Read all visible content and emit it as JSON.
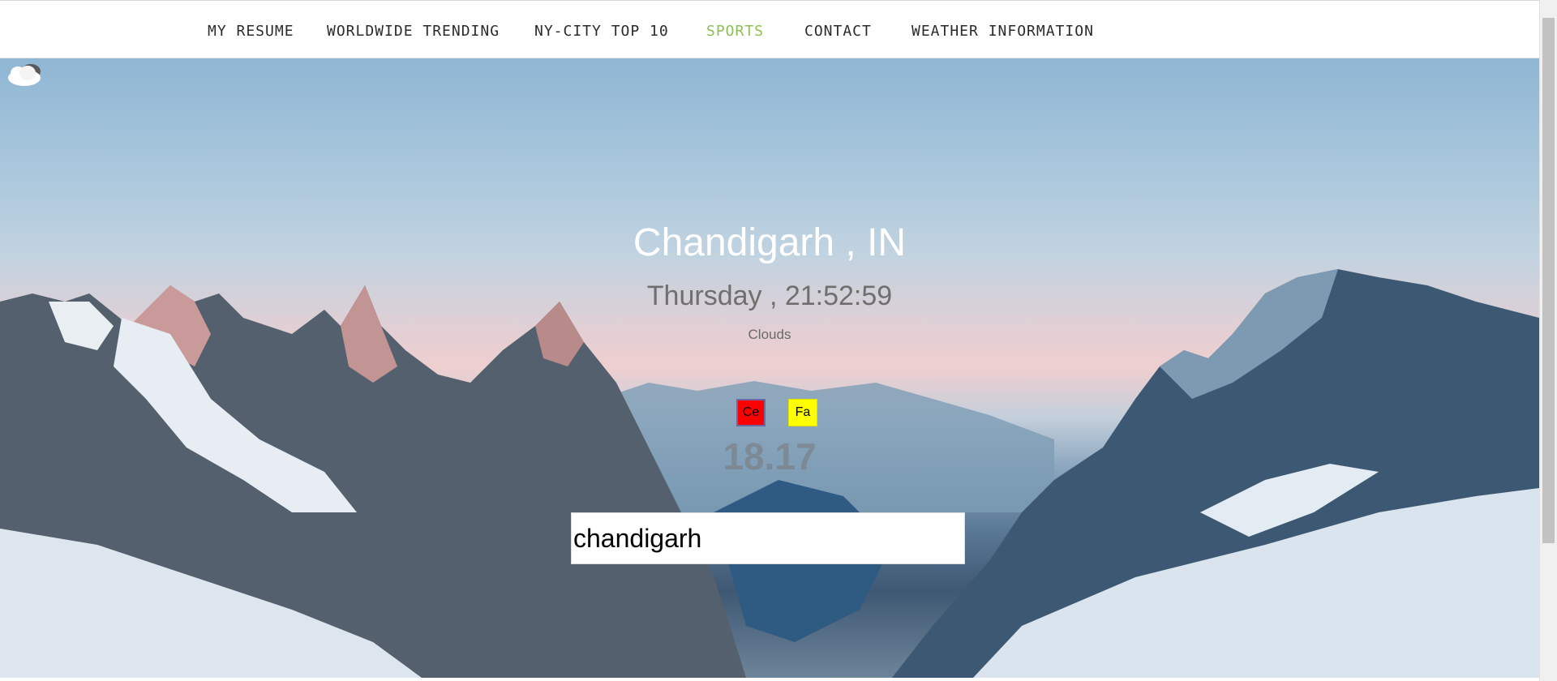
{
  "nav": {
    "items": [
      {
        "label": "MY RESUME"
      },
      {
        "label": "WORLDWIDE TRENDING"
      },
      {
        "label": "NY-CITY TOP 10"
      },
      {
        "label": "SPORTS"
      },
      {
        "label": "CONTACT"
      },
      {
        "label": "WEATHER INFORMATION"
      }
    ],
    "active_color": "#8cc152"
  },
  "weather": {
    "location": "Chandigarh , IN",
    "datetime": "Thursday , 21:52:59",
    "condition": "Clouds",
    "icon": "cloud-icon",
    "unit_celsius_label": "Ce",
    "unit_fahrenheit_label": "Fa",
    "unit_celsius_color": "#ff0000",
    "unit_fahrenheit_color": "#ffff00",
    "temperature": "18.17"
  },
  "search": {
    "value": "chandigarh"
  }
}
